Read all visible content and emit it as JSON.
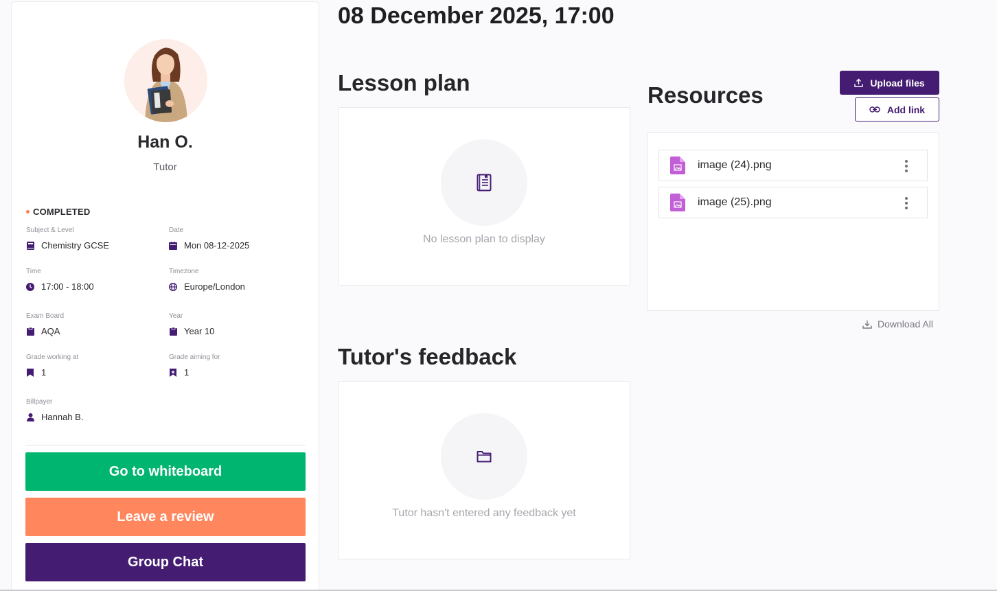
{
  "lesson": {
    "datetime": "08 December 2025, 17:00"
  },
  "tutor": {
    "name": "Han O.",
    "role": "Tutor",
    "avatar_icon": "tutor-avatar"
  },
  "status": {
    "label": "COMPLETED",
    "dot_color": "#ff7a50"
  },
  "details": {
    "subject": {
      "label": "Subject & Level",
      "value": "Chemistry GCSE",
      "icon": "book-icon"
    },
    "date": {
      "label": "Date",
      "value": "Mon 08-12-2025",
      "icon": "calendar-icon"
    },
    "time": {
      "label": "Time",
      "value": "17:00 - 18:00",
      "icon": "clock-icon"
    },
    "timezone": {
      "label": "Timezone",
      "value": "Europe/London",
      "icon": "globe-icon"
    },
    "exam_board": {
      "label": "Exam Board",
      "value": "AQA",
      "icon": "clipboard-icon"
    },
    "year": {
      "label": "Year",
      "value": "Year 10",
      "icon": "clipboard-icon"
    },
    "grade_working": {
      "label": "Grade working at",
      "value": "1",
      "icon": "bookmark-icon"
    },
    "grade_aiming": {
      "label": "Grade aiming for",
      "value": "1",
      "icon": "bookmark-star-icon"
    },
    "billpayer": {
      "label": "Billpayer",
      "value": "Hannah B.",
      "icon": "person-icon"
    }
  },
  "actions": {
    "whiteboard": "Go to whiteboard",
    "review": "Leave a review",
    "chat": "Group Chat"
  },
  "lesson_plan": {
    "title": "Lesson plan",
    "empty_text": "No lesson plan to display",
    "icon": "notebook-icon"
  },
  "feedback": {
    "title": "Tutor's feedback",
    "empty_text": "Tutor hasn't entered any feedback yet",
    "icon": "folder-icon"
  },
  "resources": {
    "title": "Resources",
    "upload_label": "Upload files",
    "add_link_label": "Add link",
    "download_all_label": "Download All",
    "files": [
      {
        "name": "image (24).png",
        "icon": "image-file-icon"
      },
      {
        "name": "image (25).png",
        "icon": "image-file-icon"
      }
    ]
  },
  "colors": {
    "brand_purple": "#441d73",
    "green": "#00b56f",
    "coral": "#ff865d",
    "file_icon": "#c25fd6"
  }
}
